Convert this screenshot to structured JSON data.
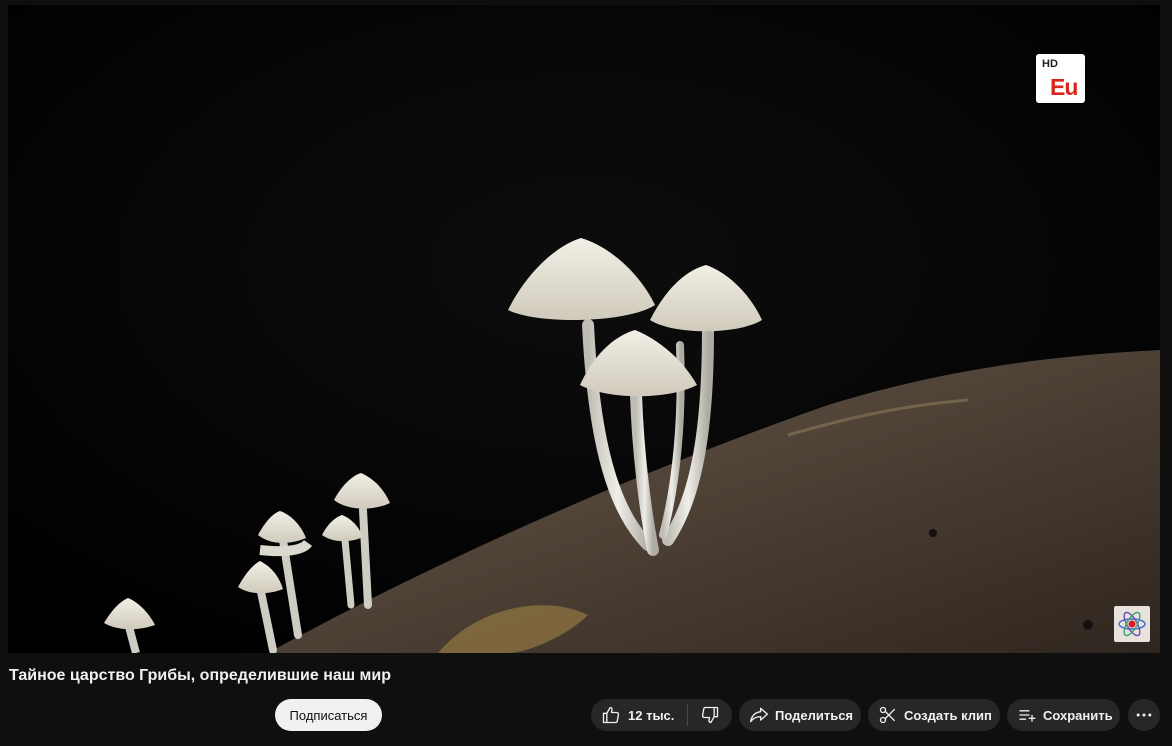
{
  "video": {
    "title": "Тайное царство Грибы, определившие наш мир",
    "hd_badge": {
      "label": "HD",
      "text": "Eu",
      "text_color": "#d9261c"
    },
    "watermark_icon": "atom-icon"
  },
  "actions": {
    "subscribe_label": "Подписаться",
    "like_count": "12 тыс.",
    "share_label": "Поделиться",
    "clip_label": "Создать клип",
    "save_label": "Сохранить",
    "icons": [
      "like-icon",
      "dislike-icon",
      "share-icon",
      "scissors-icon",
      "playlist-add-icon",
      "more-icon"
    ]
  },
  "colors": {
    "background": "#0f0f0f",
    "pill": "#272727",
    "subscribe_bg": "#f1f1f1"
  }
}
